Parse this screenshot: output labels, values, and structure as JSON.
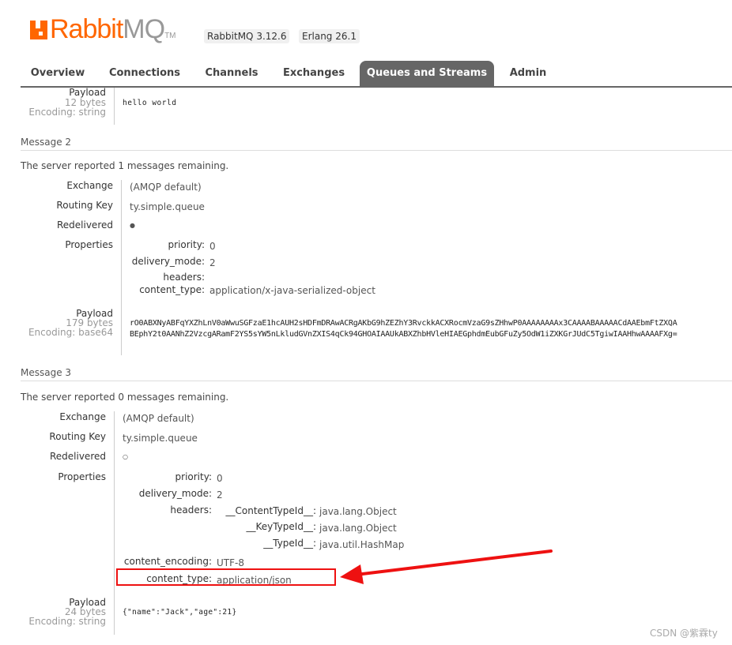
{
  "header": {
    "logo_text_orange": "Rabbit",
    "logo_text_gray": "MQ",
    "logo_tm": "TM",
    "version_badge": "RabbitMQ 3.12.6",
    "erlang_badge": "Erlang 26.1"
  },
  "tabs": [
    {
      "label": "Overview"
    },
    {
      "label": "Connections"
    },
    {
      "label": "Channels"
    },
    {
      "label": "Exchanges"
    },
    {
      "label": "Queues and Streams",
      "active": true
    },
    {
      "label": "Admin"
    }
  ],
  "labels": {
    "exchange": "Exchange",
    "routing_key": "Routing Key",
    "redelivered": "Redelivered",
    "properties": "Properties",
    "payload": "Payload"
  },
  "message1": {
    "payload_size": "12 bytes",
    "payload_encoding": "Encoding: string",
    "payload": "hello world"
  },
  "message2": {
    "title": "Message 2",
    "remaining": "The server reported 1 messages remaining.",
    "exchange": "(AMQP default)",
    "routing_key": "ty.simple.queue",
    "redelivered": "●",
    "properties": [
      {
        "key": "priority:",
        "value": "0"
      },
      {
        "key": "delivery_mode:",
        "value": "2"
      },
      {
        "key": "headers:",
        "value": ""
      },
      {
        "key": "content_type:",
        "value": "application/x-java-serialized-object"
      }
    ],
    "payload_size": "179 bytes",
    "payload_encoding": "Encoding: base64",
    "payload_line1": "rO0ABXNyABFqYXZhLnV0aWwuSGFzaE1hcAUH2sHDFmDRAwACRgAKbG9hZEZhY3RvckkACXRocmVzaG9sZHhwP0AAAAAAAAx3CAAAABAAAAACdAAEbmFtZXQA",
    "payload_line2": "BEphY2t0AANhZ2VzcgARamF2YS5sYW5nLkludGVnZXIS4qCk94GHOAIAAUkABXZhbHVleHIAEGphdmEubGFuZy5OdW1iZXKGrJUdC5TgiwIAAHhwAAAAFXg="
  },
  "message3": {
    "title": "Message 3",
    "remaining": "The server reported 0 messages remaining.",
    "exchange": "(AMQP default)",
    "routing_key": "ty.simple.queue",
    "redelivered": "○",
    "properties": [
      {
        "key": "priority:",
        "value": "0"
      },
      {
        "key": "delivery_mode:",
        "value": "2"
      },
      {
        "key": "headers:",
        "value": ""
      },
      {
        "key": "content_encoding:",
        "value": "UTF-8"
      },
      {
        "key": "content_type:",
        "value": "application/json"
      }
    ],
    "headers": [
      {
        "key": "__ContentTypeId__:",
        "value": "java.lang.Object"
      },
      {
        "key": "__KeyTypeId__:",
        "value": "java.lang.Object"
      },
      {
        "key": "__TypeId__:",
        "value": "java.util.HashMap"
      }
    ],
    "payload_size": "24 bytes",
    "payload_encoding": "Encoding: string",
    "payload": "{\"name\":\"Jack\",\"age\":21}"
  },
  "annotation": {
    "color": "#e11111"
  },
  "watermark": "CSDN @紫霖ty"
}
